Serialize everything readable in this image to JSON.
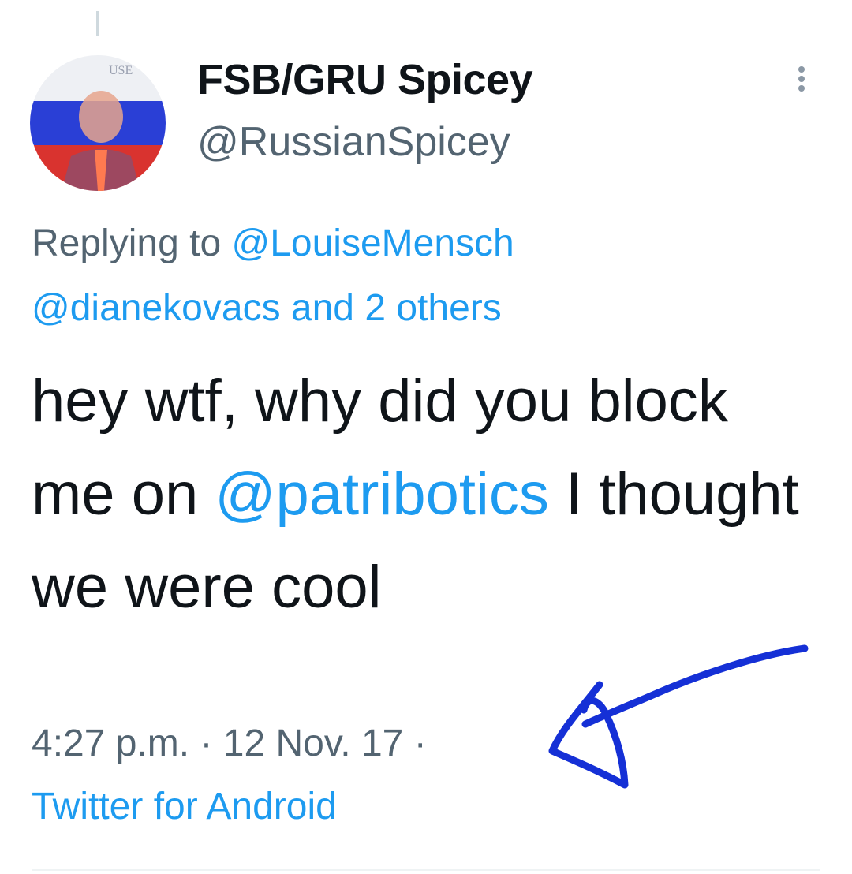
{
  "tweet": {
    "display_name": "FSB/GRU Spicey",
    "handle": "@RussianSpicey",
    "replying_prefix": "Replying to ",
    "reply_target_1": "@LouiseMensch",
    "reply_target_2": "@dianekovacs",
    "reply_suffix": " and 2 others",
    "text_part_1": "hey wtf, why did you block me on ",
    "mention": "@patribotics",
    "text_part_2": " I thought we were cool",
    "time": "4:27 p.m.",
    "separator": " · ",
    "date": "12 Nov. 17",
    "trailing_separator": " ·",
    "source": "Twitter for Android"
  },
  "icons": {
    "more": "more-vertical-icon",
    "annotation": "hand-drawn-arrow"
  },
  "colors": {
    "text": "#0f1419",
    "secondary": "#536471",
    "link": "#1d9bf0",
    "annotation": "#1530d6",
    "flag_white": "#f4f4f4",
    "flag_blue": "#2a3fd6",
    "flag_red": "#d9332f"
  }
}
